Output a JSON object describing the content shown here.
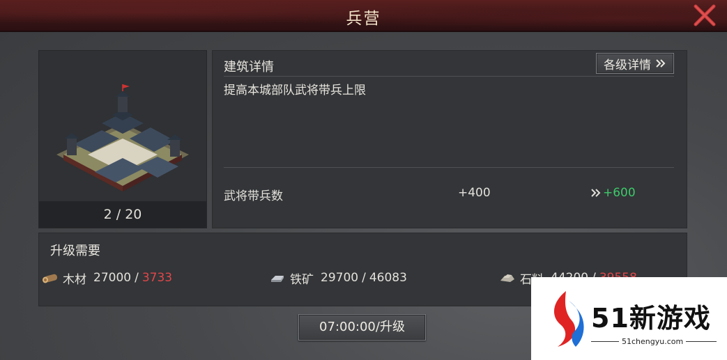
{
  "window": {
    "title": "兵营"
  },
  "building": {
    "level": "2 / 20"
  },
  "details": {
    "title": "建筑详情",
    "levels_button": "各级详情",
    "description": "提高本城部队武将带兵上限",
    "stat": {
      "label": "武将带兵数",
      "current": "+400",
      "next": "+600"
    }
  },
  "requirements": {
    "title": "升级需要",
    "items": [
      {
        "name": "木材",
        "need": "27000",
        "have": "3733",
        "sufficient": false,
        "icon": "wood-icon"
      },
      {
        "name": "铁矿",
        "need": "29700",
        "have": "46083",
        "sufficient": true,
        "icon": "iron-icon"
      },
      {
        "name": "石料",
        "need": "44200",
        "have": "39558",
        "sufficient": false,
        "icon": "stone-icon"
      }
    ]
  },
  "upgrade": {
    "label": "07:00:00/升级"
  },
  "watermark": {
    "brand": "51新游戏",
    "url": "51chengyu.com"
  },
  "colors": {
    "positive": "#3ec96a",
    "insufficient": "#e0474a",
    "title_bar": "#3a1516"
  }
}
